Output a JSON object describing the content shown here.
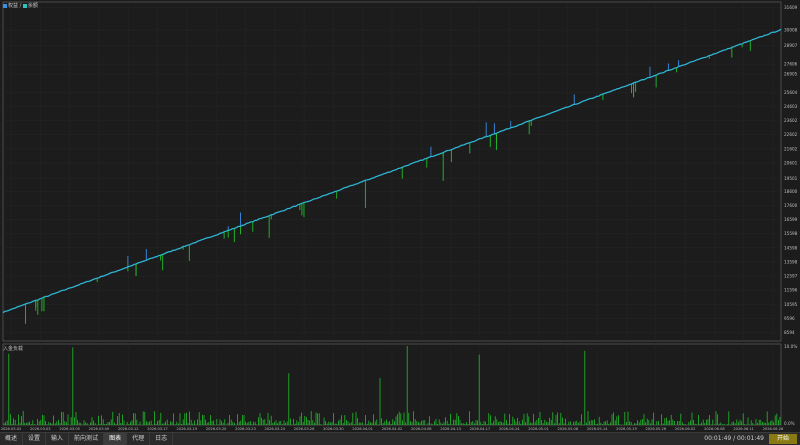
{
  "legend": {
    "items": [
      {
        "label": "权益",
        "color": "#3a8ee8"
      },
      {
        "label": "余额",
        "color": "#27c6c0"
      }
    ]
  },
  "colors": {
    "background": "#1c1c1c",
    "grid": "#2e2e2e",
    "axis_text": "#bdbdbd",
    "equity": "#3a8ee8",
    "balance": "#27c6c0",
    "drawdown": "#1fbf2a"
  },
  "subchart": {
    "label": "入金负载"
  },
  "tabs": [
    {
      "label": "概述",
      "active": false
    },
    {
      "label": "设置",
      "active": false
    },
    {
      "label": "输入",
      "active": false
    },
    {
      "label": "前向测试",
      "active": false
    },
    {
      "label": "图表",
      "active": true
    },
    {
      "label": "代理",
      "active": false
    },
    {
      "label": "日志",
      "active": false
    }
  ],
  "timer": "00:01:49 / 00:01:49",
  "start_button": "开始",
  "chart_data": [
    {
      "type": "line",
      "series": [
        {
          "name": "权益",
          "color": "#3a8ee8"
        },
        {
          "name": "余额",
          "color": "#27c6c0"
        }
      ],
      "x_ticks": [
        "2026.03.02",
        "2026.03.03",
        "2026.03.05",
        "2026.03.09",
        "2026.03.12",
        "2026.03.17",
        "2026.03.19",
        "2026.03.20",
        "2026.03.23",
        "2026.03.24",
        "2026.03.26",
        "2026.03.30",
        "2026.04.01",
        "2026.04.02",
        "2026.04.08",
        "2026.04.13",
        "2026.04.17",
        "2026.04.24",
        "2026.05.01",
        "2026.05.08",
        "2026.05.14",
        "2026.05.19",
        "2026.05.26",
        "2026.06.02",
        "2026.06.08",
        "2026.06.11",
        "2026.06.26"
      ],
      "y_ticks": [
        31609,
        30008,
        28907,
        27606,
        26905,
        25604,
        24603,
        23602,
        22602,
        21602,
        20601,
        19501,
        18600,
        17600,
        16599,
        15598,
        14598,
        13598,
        12597,
        11596,
        10595,
        9596,
        8594
      ],
      "y_range": [
        8000,
        32000
      ],
      "start_value": 10030,
      "end_value": 30050,
      "grid": true
    },
    {
      "type": "bar",
      "title": "入金负载",
      "y_ticks": [
        "10.0%",
        "0.0%"
      ],
      "y_range": [
        0,
        10
      ]
    }
  ]
}
